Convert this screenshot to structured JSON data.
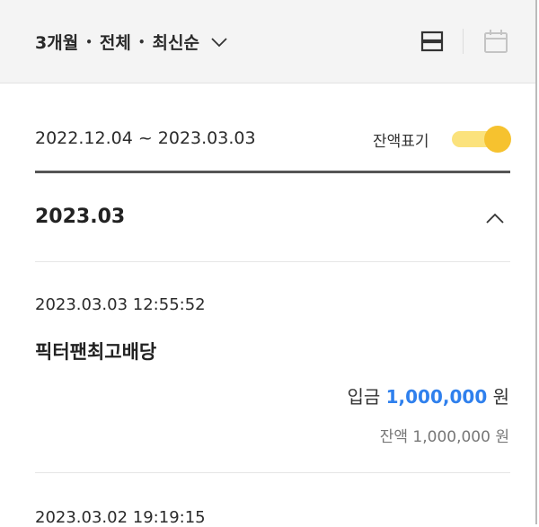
{
  "filter": {
    "period": "3개월",
    "scope": "전체",
    "order": "최신순",
    "separator": "•"
  },
  "view_icons": [
    "list-icon",
    "calendar-icon"
  ],
  "date_range": "2022.12.04 ~ 2023.03.03",
  "balance_toggle": {
    "label": "잔액표기",
    "on": true
  },
  "colors": {
    "accent_amount": "#2f80ed",
    "toggle_track": "#fbe27c",
    "toggle_knob": "#f6c22f"
  },
  "month_group": {
    "title": "2023.03"
  },
  "transactions": [
    {
      "time": "2023.03.03 12:55:52",
      "name": "픽터팬최고배당",
      "type_label": "입금",
      "amount": "1,000,000",
      "currency": "원",
      "balance_label": "잔액",
      "balance": "1,000,000",
      "balance_currency": "원"
    },
    {
      "time": "2023.03.02 19:19:15"
    }
  ]
}
